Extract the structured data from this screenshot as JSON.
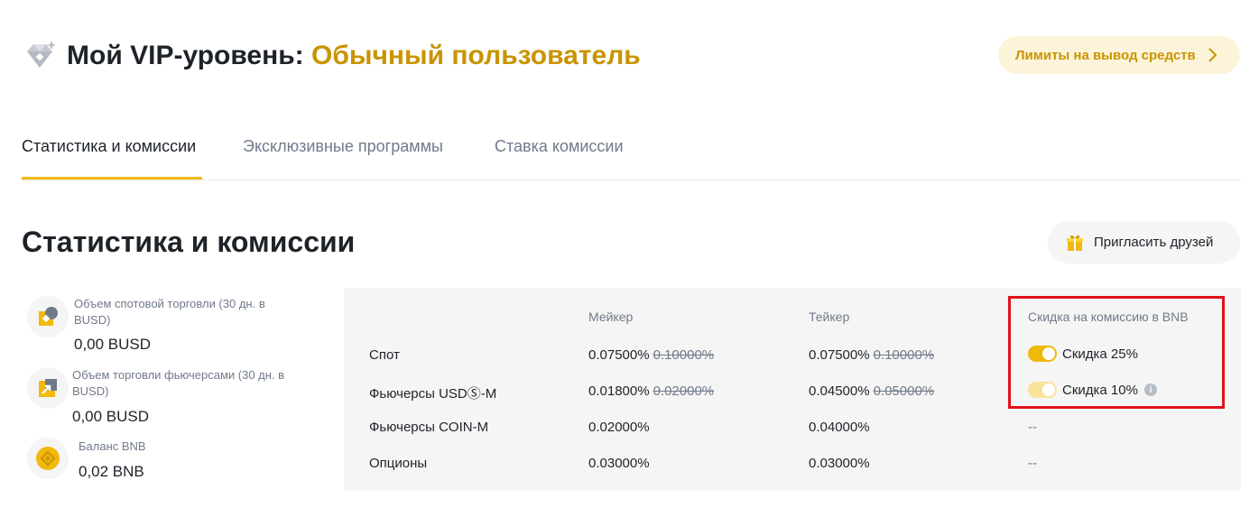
{
  "header": {
    "title_prefix": "Мой VIP-уровень:",
    "title_level": "Обычный пользователь",
    "limits_button": "Лимиты на вывод средств"
  },
  "tabs": [
    {
      "label": "Статистика и комиссии",
      "active": true
    },
    {
      "label": "Эксклюзивные программы",
      "active": false
    },
    {
      "label": "Ставка комиссии",
      "active": false
    }
  ],
  "section": {
    "title": "Статистика и комиссии",
    "invite_button": "Пригласить друзей"
  },
  "stats": [
    {
      "label": "Объем спотовой торговли (30 дн. в BUSD)",
      "value": "0,00 BUSD"
    },
    {
      "label": "Объем торговли фьючерсами (30 дн. в BUSD)",
      "value": "0,00 BUSD"
    },
    {
      "label": "Баланс BNB",
      "value": "0,02 BNB"
    }
  ],
  "fees": {
    "headers": {
      "maker": "Мейкер",
      "taker": "Тейкер",
      "discount": "Скидка на комиссию в BNB"
    },
    "rows": [
      {
        "name": "Спот",
        "maker": "0.07500%",
        "maker_old": "0.10000%",
        "taker": "0.07500%",
        "taker_old": "0.10000%",
        "discount": "Скидка 25%"
      },
      {
        "name": "Фьючерсы USDⓈ-M",
        "maker": "0.01800%",
        "maker_old": "0.02000%",
        "taker": "0.04500%",
        "taker_old": "0.05000%",
        "discount": "Скидка 10%"
      },
      {
        "name": "Фьючерсы COIN-M",
        "maker": "0.02000%",
        "taker": "0.04000%",
        "discount": "--"
      },
      {
        "name": "Опционы",
        "maker": "0.03000%",
        "taker": "0.03000%",
        "discount": "--"
      }
    ]
  },
  "colors": {
    "accent": "#f0b90b",
    "level": "#c99400",
    "highlight": "#e0111a"
  }
}
